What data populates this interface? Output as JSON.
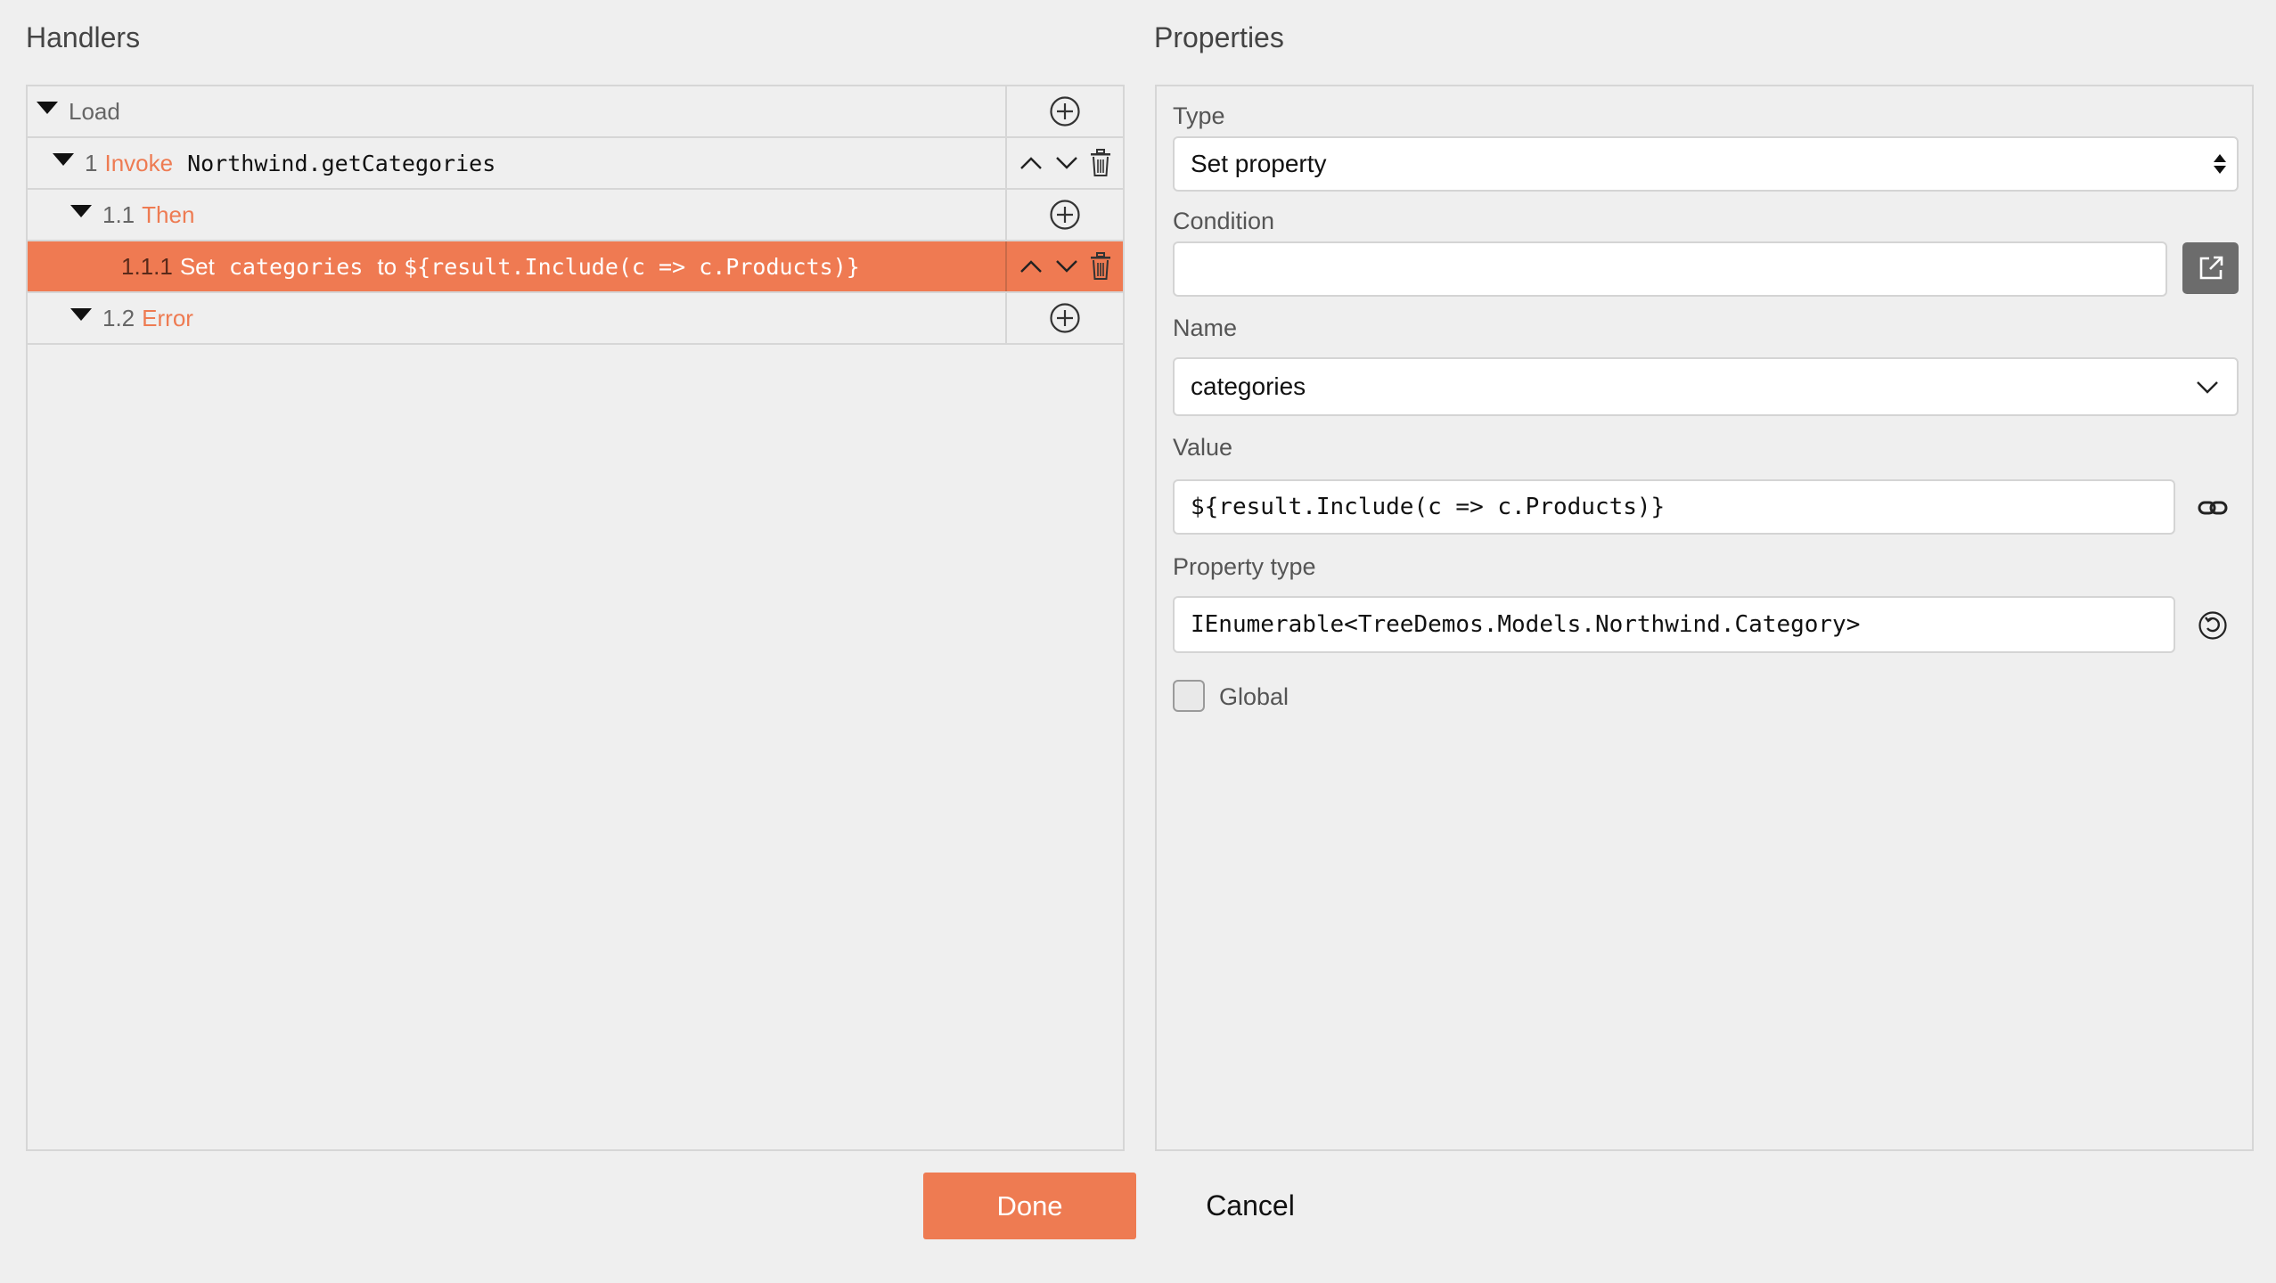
{
  "handlers": {
    "title": "Handlers",
    "rows": [
      {
        "toggle": true,
        "label": "Load"
      },
      {
        "num": "1",
        "kw": "Invoke",
        "code": "Northwind.getCategories"
      },
      {
        "num": "1.1",
        "kw": "Then"
      },
      {
        "num": "1.1.1",
        "kw": "Set",
        "code": "categories",
        "to": "to",
        "expr": "${result.Include(c => c.Products)}"
      },
      {
        "num": "1.2",
        "kw": "Error"
      }
    ]
  },
  "properties": {
    "title": "Properties",
    "type": {
      "label": "Type",
      "value": "Set property"
    },
    "condition": {
      "label": "Condition",
      "value": ""
    },
    "name": {
      "label": "Name",
      "value": "categories"
    },
    "value": {
      "label": "Value",
      "value": "${result.Include(c => c.Products)}"
    },
    "property_type": {
      "label": "Property type",
      "value": "IEnumerable<TreeDemos.Models.Northwind.Category>"
    },
    "global": {
      "label": "Global",
      "checked": false
    }
  },
  "footer": {
    "done_label": "Done",
    "cancel_label": "Cancel"
  },
  "colors": {
    "accent": "#ee7b52",
    "background": "#efefef"
  },
  "icons": {
    "add": "plus-circle-icon",
    "up": "chevron-up-icon",
    "down": "chevron-down-icon",
    "delete": "trash-icon",
    "open": "open-external-icon",
    "link": "link-icon",
    "refresh": "refresh-icon",
    "dropdown": "chevron-down-icon"
  }
}
